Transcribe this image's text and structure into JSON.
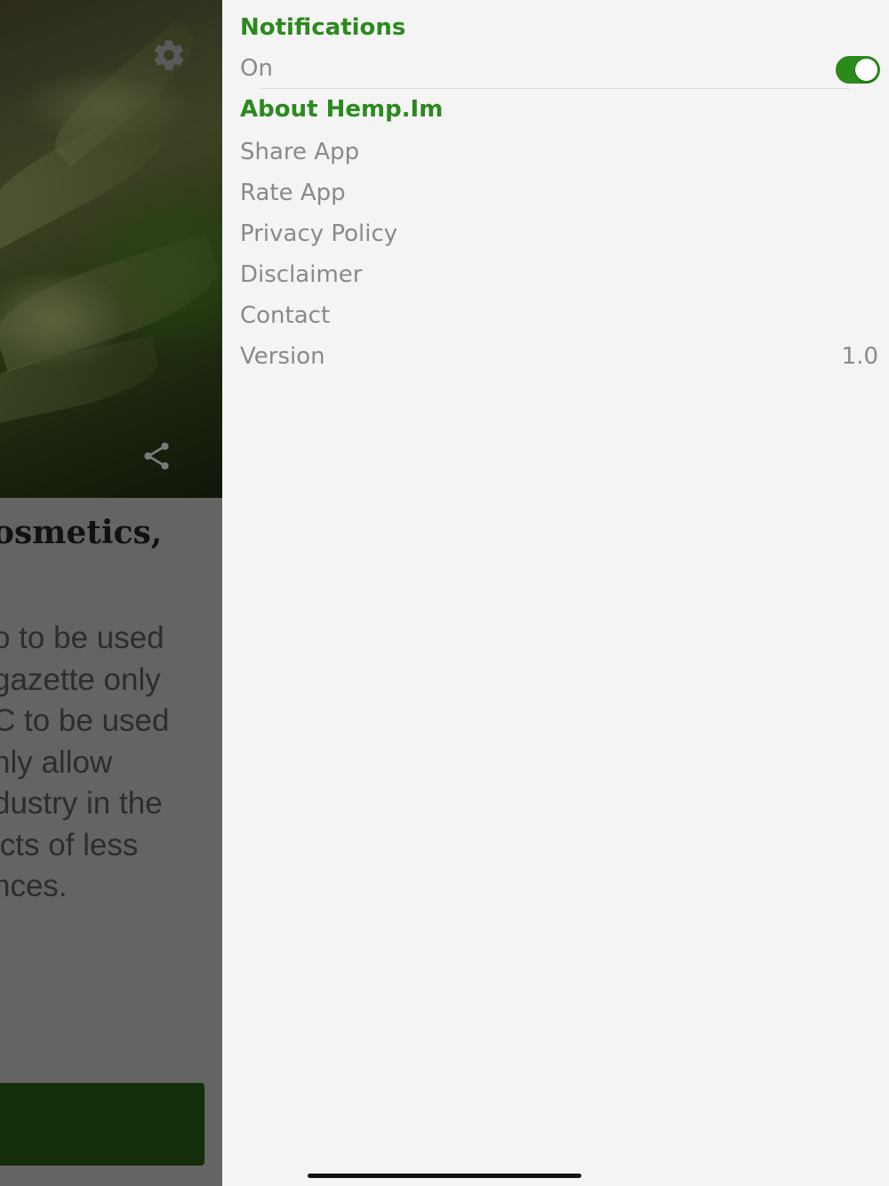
{
  "colors": {
    "accent": "#2b8a1d",
    "toggle_on": "#2a8a1a",
    "menu_text": "#8a8a8a",
    "drawer_bg": "#f4f4f4",
    "overlay": "#646464",
    "cta_bar": "#132e0a"
  },
  "background_article": {
    "icons": [
      "gear-icon",
      "share-icon"
    ],
    "title_fragment": "osmetics,",
    "body_lines": [
      "o to be used",
      "gazette only",
      "C to be used",
      "nly allow",
      "dustry in the",
      "icts of less",
      "nces."
    ]
  },
  "settings": {
    "notifications": {
      "title": "Notifications",
      "label": "On",
      "enabled": true
    },
    "about": {
      "title": "About Hemp.Im",
      "items": [
        {
          "label": "Share App"
        },
        {
          "label": "Rate App"
        },
        {
          "label": "Privacy Policy"
        },
        {
          "label": "Disclaimer"
        },
        {
          "label": "Contact"
        }
      ],
      "version_label": "Version",
      "version_value": "1.0"
    }
  }
}
